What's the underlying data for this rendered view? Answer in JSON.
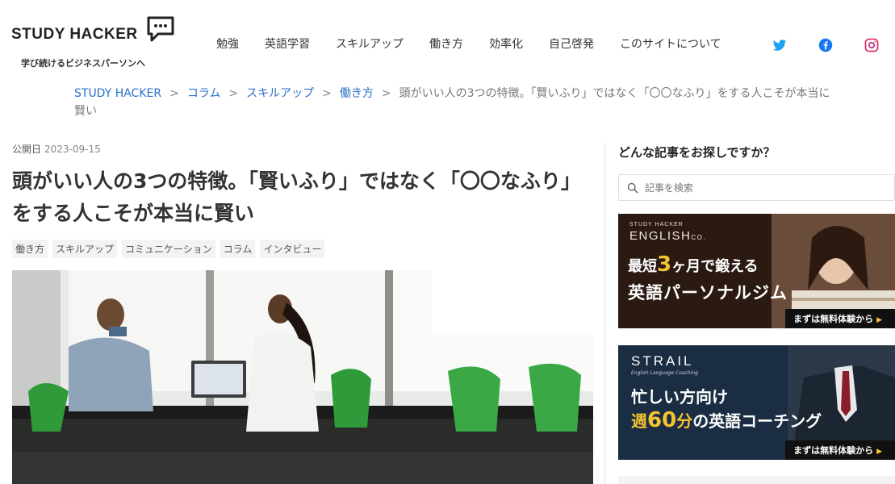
{
  "header": {
    "logo_text": "STUDY HACKER",
    "tagline": "学び続けるビジネスパーソンへ",
    "nav": [
      "勉強",
      "英語学習",
      "スキルアップ",
      "働き方",
      "効率化",
      "自己啓発",
      "このサイトについて"
    ],
    "social": [
      "twitter-icon",
      "facebook-icon",
      "instagram-icon"
    ]
  },
  "breadcrumb": {
    "items": [
      "STUDY HACKER",
      "コラム",
      "スキルアップ",
      "働き方"
    ],
    "separator": ">",
    "current": "頭がいい人の3つの特徴。「賢いふり」ではなく「〇〇なふり」をする人こそが本当に賢い"
  },
  "article": {
    "date_label": "公開日",
    "date": "2023-09-15",
    "title": "頭がいい人の3つの特徴。「賢いふり」ではなく「〇〇なふり」をする人こそが本当に賢い",
    "tags": [
      "働き方",
      "スキルアップ",
      "コミュニケーション",
      "コラム",
      "インタビュー"
    ]
  },
  "sidebar": {
    "heading": "どんな記事をお探しですか？",
    "search_placeholder": "記事を検索",
    "banner1": {
      "brand_small": "STUDY HACKER",
      "brand": "ENGLISH",
      "brand_suffix": "CO.",
      "line1_a": "最短",
      "line1_num": "3",
      "line1_b": "ヶ月",
      "line1_c": "で鍛える",
      "line2": "英語パーソナルジム",
      "cta": "まずは無料体験から"
    },
    "banner2": {
      "brand": "STRAIL",
      "sub": "English Language Coaching",
      "line1": "忙しい方向け",
      "line2_a": "週",
      "line2_num": "60",
      "line2_b": "分",
      "line2_c": "の英語コーチング",
      "cta": "まずは無料体験から"
    }
  },
  "colors": {
    "link": "#2a70c8",
    "twitter": "#1da1f2",
    "facebook": "#1877f2",
    "instagram": "#e1306c",
    "banner_accent": "#f4c430"
  }
}
